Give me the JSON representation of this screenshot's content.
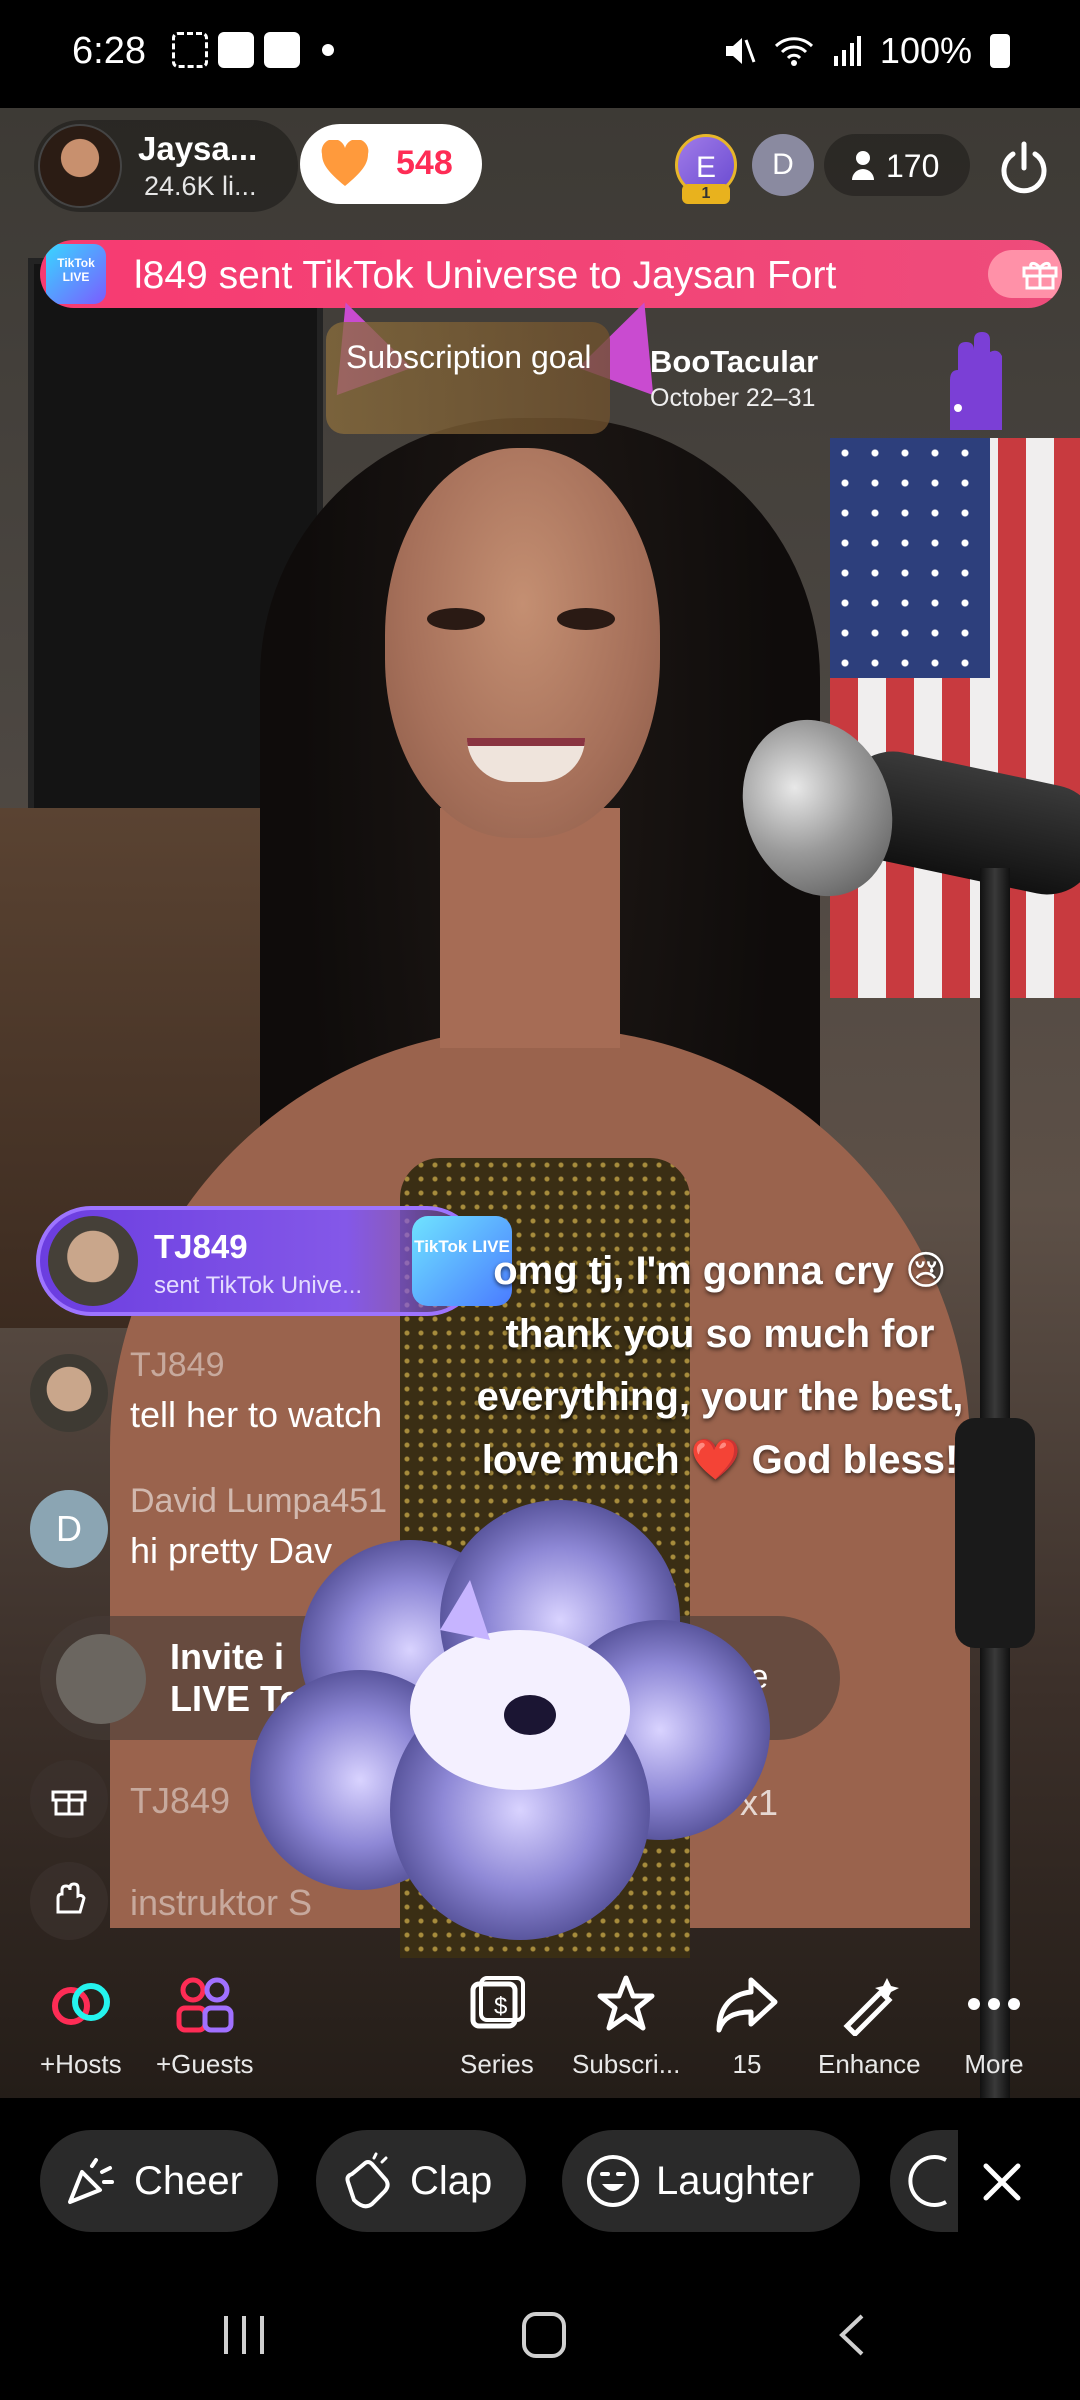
{
  "status_bar": {
    "time": "6:28",
    "battery": "100%",
    "icons": [
      "screenshot-icon",
      "app-icon",
      "app-icon",
      "dot-icon",
      "mute-icon",
      "wifi-icon",
      "signal-icon",
      "battery-icon"
    ]
  },
  "host": {
    "name": "Jaysa...",
    "likes": "24.6K li...",
    "like_count": "548"
  },
  "viewers": {
    "avatar1": "E",
    "avatar1_rank": "1",
    "avatar2": "D",
    "count": "170"
  },
  "ticker": {
    "logo": "TikTok LIVE",
    "text": "l849 sent TikTok Universe to Jaysan Fort"
  },
  "goal": {
    "label": "Subscription goal",
    "event_title": "BooTacular",
    "event_dates": "October 22–31"
  },
  "gift_banner": {
    "user": "TJ849",
    "desc": "sent TikTok Unive...",
    "thumb": "TikTok LIVE"
  },
  "chat": [
    {
      "name": "TJ849",
      "text": "tell her to watch"
    },
    {
      "name": "David Lumpa451",
      "text": "hi pretty Dav",
      "avatar_letter": "D"
    }
  ],
  "invite": {
    "text": "Invite i LIVE To",
    "button": "te"
  },
  "system": [
    {
      "text": "TJ849",
      "combo": "x1"
    },
    {
      "text": "instruktor S"
    }
  ],
  "streamer_message": "omg tj, I'm gonna cry 😢 thank you so much for everything, your the best, love much ❤️ God bless!",
  "tools": [
    {
      "label": "+Hosts",
      "icon": "hosts-icon"
    },
    {
      "label": "+Guests",
      "icon": "guests-icon"
    },
    {
      "label": "Series",
      "icon": "series-icon"
    },
    {
      "label": "Subscri...",
      "icon": "subscription-icon"
    },
    {
      "label": "15",
      "icon": "share-icon"
    },
    {
      "label": "Enhance",
      "icon": "enhance-icon"
    },
    {
      "label": "More",
      "icon": "more-icon"
    }
  ],
  "reactions": [
    {
      "label": "Cheer",
      "icon": "cheer-icon"
    },
    {
      "label": "Clap",
      "icon": "clap-icon"
    },
    {
      "label": "Laughter",
      "icon": "laughter-icon"
    }
  ],
  "colors": {
    "ticker": "#f73b71",
    "like": "#fe2c55",
    "gift_banner": "#6b3de0",
    "heart": "#ff9a3c"
  }
}
